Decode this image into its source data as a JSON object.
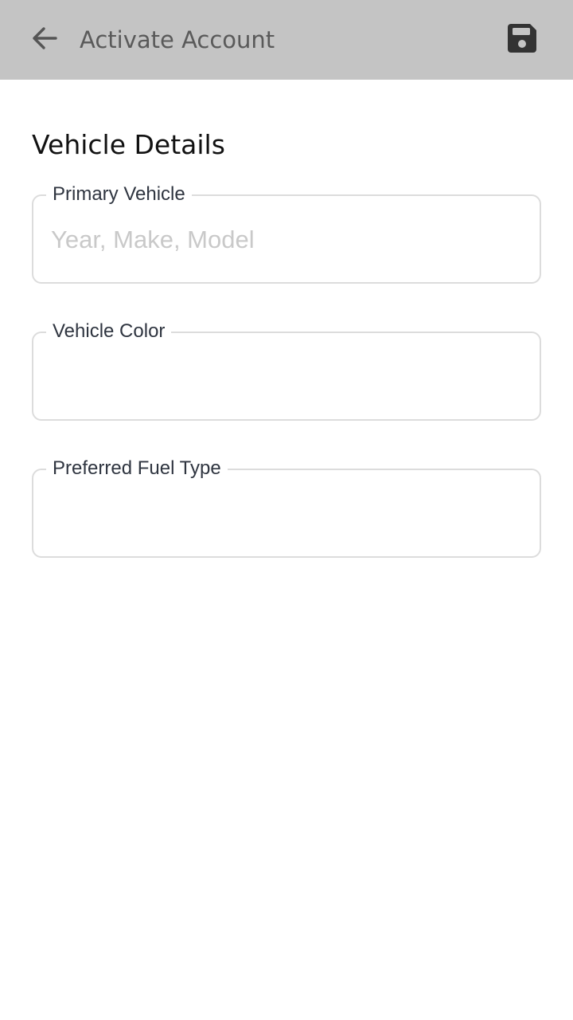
{
  "app_bar": {
    "title": "Activate Account",
    "back_icon": "arrow-left-icon",
    "save_icon": "floppy-disk-icon",
    "background": "#c4c4c4"
  },
  "section": {
    "title": "Vehicle Details"
  },
  "fields": [
    {
      "label": "Primary Vehicle",
      "placeholder": "Year, Make, Model",
      "value": ""
    },
    {
      "label": "Vehicle Color",
      "placeholder": "",
      "value": ""
    },
    {
      "label": "Preferred Fuel Type",
      "placeholder": "",
      "value": ""
    }
  ]
}
